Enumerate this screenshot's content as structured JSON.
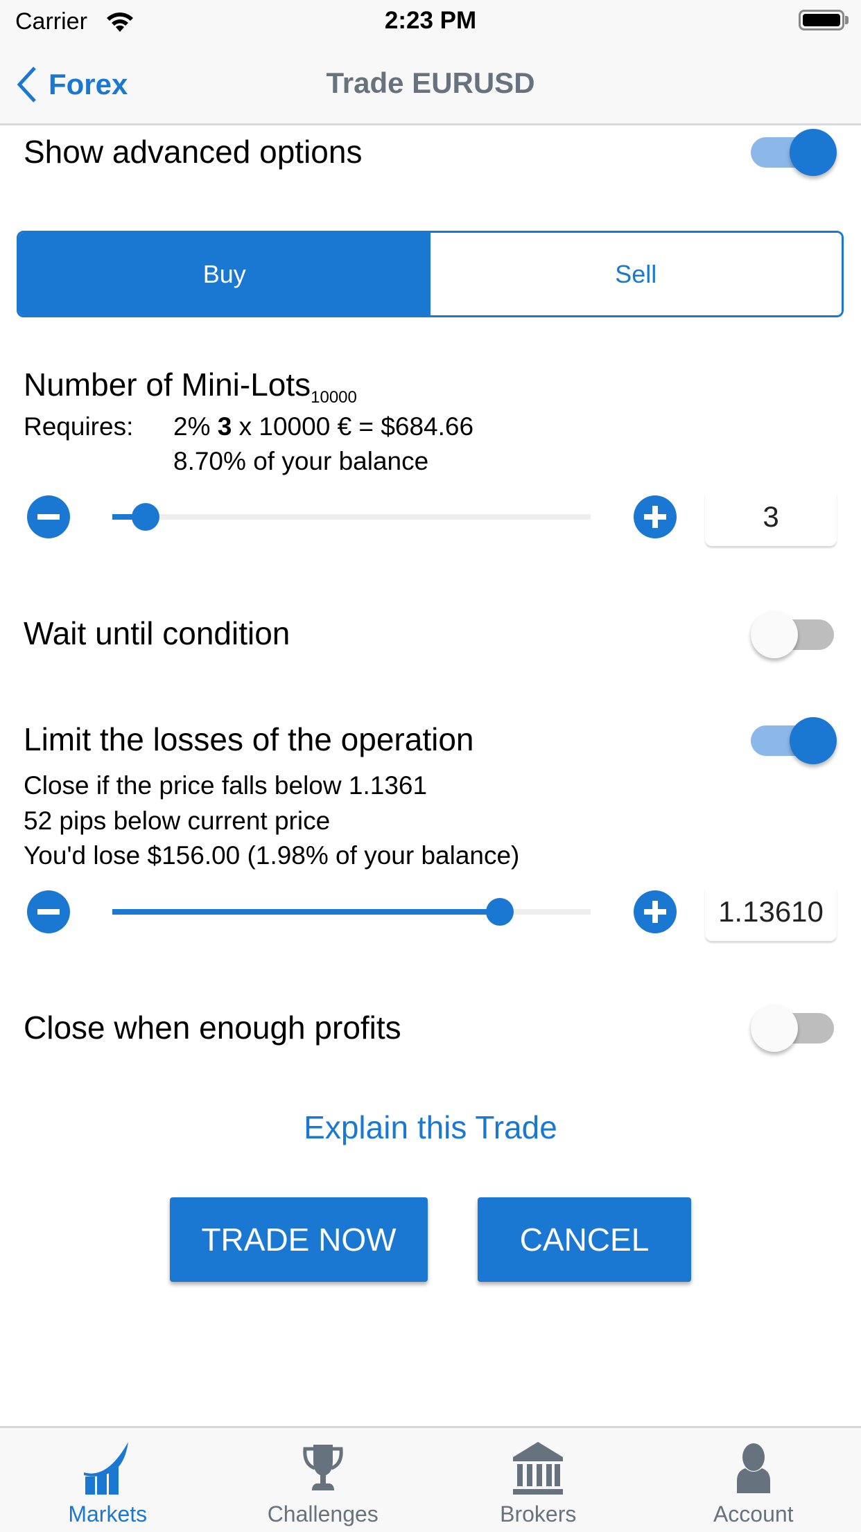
{
  "status_bar": {
    "carrier": "Carrier",
    "time": "2:23 PM"
  },
  "nav": {
    "back_label": "Forex",
    "title": "Trade EURUSD"
  },
  "advanced": {
    "label": "Show advanced options",
    "enabled": true
  },
  "side_selector": {
    "options": [
      "Buy",
      "Sell"
    ],
    "selected": "Buy"
  },
  "lots": {
    "title": "Number of Mini-Lots",
    "title_subscript": "10000",
    "requires_label": "Requires:",
    "requires_prefix": "2% ",
    "requires_qty": "3",
    "requires_suffix": " x 10000 € = $684.66",
    "balance_pct": "8.70% of your balance",
    "value": "3",
    "slider_fraction": 0.07
  },
  "wait_condition": {
    "label": "Wait until condition",
    "enabled": false
  },
  "stop_loss": {
    "label": "Limit the losses of the operation",
    "enabled": true,
    "line1": "Close if the price falls below 1.1361",
    "line2": "52 pips below current price",
    "line3": "You'd lose $156.00 (1.98% of your balance)",
    "value": "1.13610",
    "slider_fraction": 0.81
  },
  "take_profit": {
    "label": "Close when enough profits",
    "enabled": false
  },
  "explain_link": "Explain this Trade",
  "actions": {
    "trade_now": "TRADE NOW",
    "cancel": "CANCEL"
  },
  "tabs": [
    {
      "label": "Markets",
      "icon": "chart-up-icon",
      "active": true
    },
    {
      "label": "Challenges",
      "icon": "trophy-icon",
      "active": false
    },
    {
      "label": "Brokers",
      "icon": "bank-icon",
      "active": false
    },
    {
      "label": "Account",
      "icon": "user-icon",
      "active": false
    }
  ],
  "colors": {
    "primary": "#1a78d2",
    "inactive_tab": "#66737f",
    "toggle_on_track": "#8bb8e8",
    "toggle_off_track": "#bdbdbd"
  }
}
